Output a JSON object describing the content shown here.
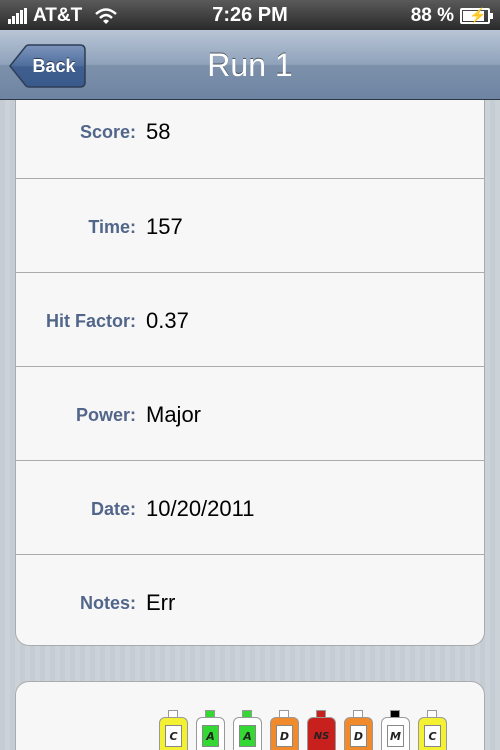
{
  "status_bar": {
    "carrier": "AT&T",
    "time": "7:26 PM",
    "battery": "88 %",
    "battery_level": 0.88
  },
  "nav": {
    "back_label": "Back",
    "title": "Run 1"
  },
  "fields": [
    {
      "label": "Score:",
      "value": "58"
    },
    {
      "label": "Time:",
      "value": "157"
    },
    {
      "label": "Hit Factor:",
      "value": "0.37"
    },
    {
      "label": "Power:",
      "value": "Major"
    },
    {
      "label": "Date:",
      "value": "10/20/2011"
    },
    {
      "label": "Notes:",
      "value": "Err"
    }
  ],
  "targets": [
    {
      "code": "C",
      "color": "#f4f032",
      "head_color": "#ffffff"
    },
    {
      "code": "A",
      "color": "#ffffff",
      "head_color": "#33d833",
      "inner_color": "#33d833"
    },
    {
      "code": "A",
      "color": "#ffffff",
      "head_color": "#33d833",
      "inner_color": "#33d833"
    },
    {
      "code": "D",
      "color": "#f08a2a",
      "head_color": "#ffffff"
    },
    {
      "code": "NS",
      "color": "#c8201c",
      "head_color": "#c8201c"
    },
    {
      "code": "D",
      "color": "#f08a2a",
      "head_color": "#ffffff"
    },
    {
      "code": "M",
      "color": "#ffffff",
      "head_color": "#000000"
    },
    {
      "code": "C",
      "color": "#f4f032",
      "head_color": "#ffffff"
    }
  ],
  "colors": {
    "label": "#52668a",
    "nav_bar": "#7d91ab",
    "background": "#c5ccd4"
  }
}
